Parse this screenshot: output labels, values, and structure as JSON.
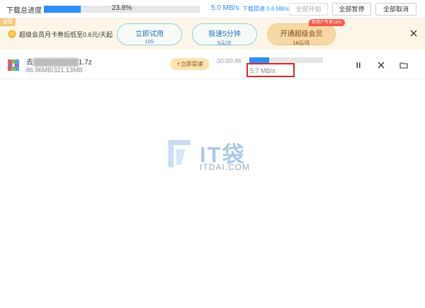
{
  "topbar": {
    "label": "下载总进度",
    "progress_percent": 23.8,
    "progress_text": "23.8%",
    "speed": "5.0 MB/s",
    "accel_label": "下载提速 5.6 MB/s",
    "start_all": "全部开始",
    "pause_all": "全部暂停",
    "cancel_all": "全部取消"
  },
  "banner": {
    "tag": "推荐",
    "message": "超级会员月卡券后低至0.6元/天起",
    "trial": {
      "title": "立即试用",
      "sub": "10S"
    },
    "turbo": {
      "title": "极速5分钟",
      "sub": "5元/次"
    },
    "svip": {
      "title": "开通超级会员",
      "sub": "18元/月",
      "badge": "新用户专享18元"
    },
    "icons": {
      "coin": "gold-coin-icon",
      "close": "close-icon"
    }
  },
  "download": {
    "name_visible": "去",
    "name_blurred": "█████████",
    "name_ext": "1.7z",
    "size": "86.86MB/321.13MB",
    "boost_label": "立即提速",
    "remaining": "00:00:46",
    "progress_percent": 27,
    "speed": "5.7 MB/s"
  },
  "watermark": {
    "brand": "IT袋",
    "domain": "ITDAI.COM"
  },
  "colors": {
    "accent": "#2f8ef4",
    "banner_bg": "#fdf6e8",
    "highlight": "#d8262b"
  }
}
